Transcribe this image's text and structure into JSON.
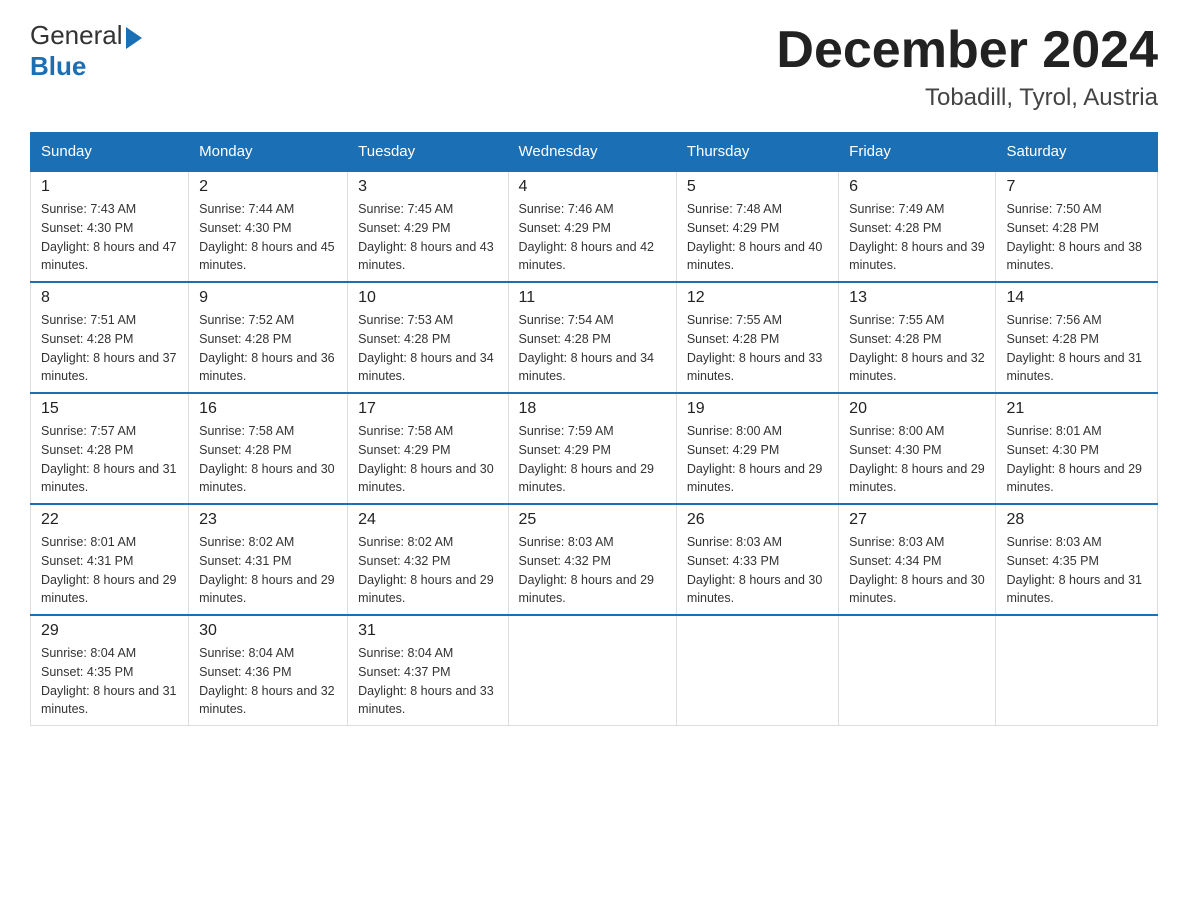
{
  "header": {
    "logo_line1": "General",
    "logo_line2": "Blue",
    "title": "December 2024",
    "subtitle": "Tobadill, Tyrol, Austria"
  },
  "weekdays": [
    "Sunday",
    "Monday",
    "Tuesday",
    "Wednesday",
    "Thursday",
    "Friday",
    "Saturday"
  ],
  "weeks": [
    [
      {
        "num": "1",
        "sunrise": "7:43 AM",
        "sunset": "4:30 PM",
        "daylight": "8 hours and 47 minutes."
      },
      {
        "num": "2",
        "sunrise": "7:44 AM",
        "sunset": "4:30 PM",
        "daylight": "8 hours and 45 minutes."
      },
      {
        "num": "3",
        "sunrise": "7:45 AM",
        "sunset": "4:29 PM",
        "daylight": "8 hours and 43 minutes."
      },
      {
        "num": "4",
        "sunrise": "7:46 AM",
        "sunset": "4:29 PM",
        "daylight": "8 hours and 42 minutes."
      },
      {
        "num": "5",
        "sunrise": "7:48 AM",
        "sunset": "4:29 PM",
        "daylight": "8 hours and 40 minutes."
      },
      {
        "num": "6",
        "sunrise": "7:49 AM",
        "sunset": "4:28 PM",
        "daylight": "8 hours and 39 minutes."
      },
      {
        "num": "7",
        "sunrise": "7:50 AM",
        "sunset": "4:28 PM",
        "daylight": "8 hours and 38 minutes."
      }
    ],
    [
      {
        "num": "8",
        "sunrise": "7:51 AM",
        "sunset": "4:28 PM",
        "daylight": "8 hours and 37 minutes."
      },
      {
        "num": "9",
        "sunrise": "7:52 AM",
        "sunset": "4:28 PM",
        "daylight": "8 hours and 36 minutes."
      },
      {
        "num": "10",
        "sunrise": "7:53 AM",
        "sunset": "4:28 PM",
        "daylight": "8 hours and 34 minutes."
      },
      {
        "num": "11",
        "sunrise": "7:54 AM",
        "sunset": "4:28 PM",
        "daylight": "8 hours and 34 minutes."
      },
      {
        "num": "12",
        "sunrise": "7:55 AM",
        "sunset": "4:28 PM",
        "daylight": "8 hours and 33 minutes."
      },
      {
        "num": "13",
        "sunrise": "7:55 AM",
        "sunset": "4:28 PM",
        "daylight": "8 hours and 32 minutes."
      },
      {
        "num": "14",
        "sunrise": "7:56 AM",
        "sunset": "4:28 PM",
        "daylight": "8 hours and 31 minutes."
      }
    ],
    [
      {
        "num": "15",
        "sunrise": "7:57 AM",
        "sunset": "4:28 PM",
        "daylight": "8 hours and 31 minutes."
      },
      {
        "num": "16",
        "sunrise": "7:58 AM",
        "sunset": "4:28 PM",
        "daylight": "8 hours and 30 minutes."
      },
      {
        "num": "17",
        "sunrise": "7:58 AM",
        "sunset": "4:29 PM",
        "daylight": "8 hours and 30 minutes."
      },
      {
        "num": "18",
        "sunrise": "7:59 AM",
        "sunset": "4:29 PM",
        "daylight": "8 hours and 29 minutes."
      },
      {
        "num": "19",
        "sunrise": "8:00 AM",
        "sunset": "4:29 PM",
        "daylight": "8 hours and 29 minutes."
      },
      {
        "num": "20",
        "sunrise": "8:00 AM",
        "sunset": "4:30 PM",
        "daylight": "8 hours and 29 minutes."
      },
      {
        "num": "21",
        "sunrise": "8:01 AM",
        "sunset": "4:30 PM",
        "daylight": "8 hours and 29 minutes."
      }
    ],
    [
      {
        "num": "22",
        "sunrise": "8:01 AM",
        "sunset": "4:31 PM",
        "daylight": "8 hours and 29 minutes."
      },
      {
        "num": "23",
        "sunrise": "8:02 AM",
        "sunset": "4:31 PM",
        "daylight": "8 hours and 29 minutes."
      },
      {
        "num": "24",
        "sunrise": "8:02 AM",
        "sunset": "4:32 PM",
        "daylight": "8 hours and 29 minutes."
      },
      {
        "num": "25",
        "sunrise": "8:03 AM",
        "sunset": "4:32 PM",
        "daylight": "8 hours and 29 minutes."
      },
      {
        "num": "26",
        "sunrise": "8:03 AM",
        "sunset": "4:33 PM",
        "daylight": "8 hours and 30 minutes."
      },
      {
        "num": "27",
        "sunrise": "8:03 AM",
        "sunset": "4:34 PM",
        "daylight": "8 hours and 30 minutes."
      },
      {
        "num": "28",
        "sunrise": "8:03 AM",
        "sunset": "4:35 PM",
        "daylight": "8 hours and 31 minutes."
      }
    ],
    [
      {
        "num": "29",
        "sunrise": "8:04 AM",
        "sunset": "4:35 PM",
        "daylight": "8 hours and 31 minutes."
      },
      {
        "num": "30",
        "sunrise": "8:04 AM",
        "sunset": "4:36 PM",
        "daylight": "8 hours and 32 minutes."
      },
      {
        "num": "31",
        "sunrise": "8:04 AM",
        "sunset": "4:37 PM",
        "daylight": "8 hours and 33 minutes."
      },
      null,
      null,
      null,
      null
    ]
  ]
}
